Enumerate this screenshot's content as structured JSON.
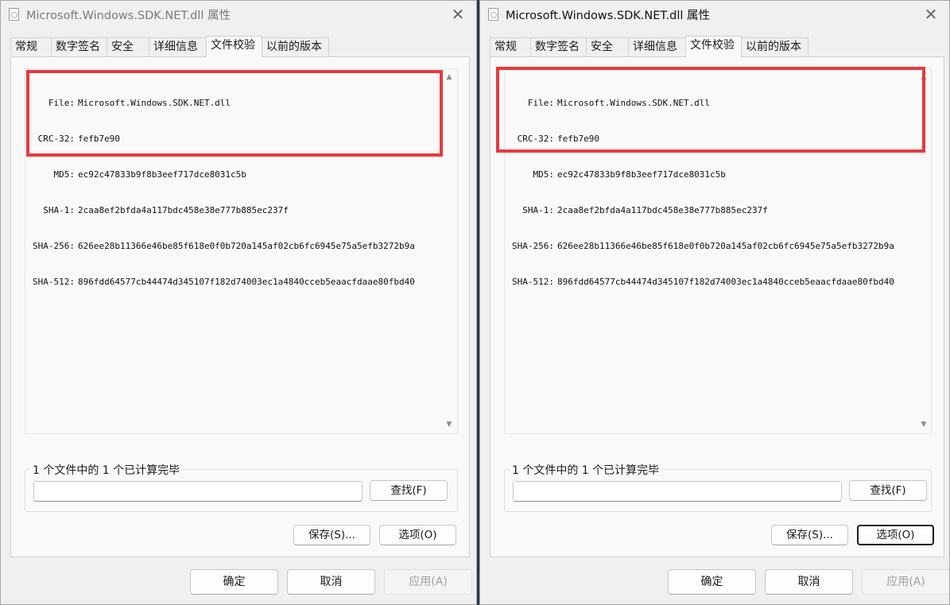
{
  "windows": [
    {
      "id": "left",
      "title": "Microsoft.Windows.SDK.NET.dll 属性",
      "tabs": [
        "常规",
        "数字签名",
        "安全",
        "详细信息",
        "文件校验",
        "以前的版本"
      ],
      "active_tab": "文件校验",
      "hashes": [
        {
          "label": "File:",
          "value": "Microsoft.Windows.SDK.NET.dll"
        },
        {
          "label": "CRC-32:",
          "value": "fefb7e90"
        },
        {
          "label": "MD5:",
          "value": "ec92c47833b9f8b3eef717dce8031c5b"
        },
        {
          "label": "SHA-1:",
          "value": "2caa8ef2bfda4a117bdc458e38e777b885ec237f"
        },
        {
          "label": "SHA-256:",
          "value": "626ee28b11366e46be85f618e0f0b720a145af02cb6fc6945e75a5efb3272b9a"
        },
        {
          "label": "SHA-512:",
          "value": "896fdd64577cb44474d345107f182d74003ec1a4840cceb5eaacfdaae80fbd40"
        }
      ],
      "status": "1 个文件中的 1 个已计算完毕",
      "search_value": "",
      "find_label": "查找(F)",
      "save_label": "保存(S)...",
      "options_label": "选项(O)",
      "ok_label": "确定",
      "cancel_label": "取消",
      "apply_label": "应用(A)"
    },
    {
      "id": "right",
      "title": "Microsoft.Windows.SDK.NET.dll 属性",
      "tabs": [
        "常规",
        "数字签名",
        "安全",
        "详细信息",
        "文件校验",
        "以前的版本"
      ],
      "active_tab": "文件校验",
      "hashes": [
        {
          "label": "File:",
          "value": "Microsoft.Windows.SDK.NET.dll"
        },
        {
          "label": "CRC-32:",
          "value": "fefb7e90"
        },
        {
          "label": "MD5:",
          "value": "ec92c47833b9f8b3eef717dce8031c5b"
        },
        {
          "label": "SHA-1:",
          "value": "2caa8ef2bfda4a117bdc458e38e777b885ec237f"
        },
        {
          "label": "SHA-256:",
          "value": "626ee28b11366e46be85f618e0f0b720a145af02cb6fc6945e75a5efb3272b9a"
        },
        {
          "label": "SHA-512:",
          "value": "896fdd64577cb44474d345107f182d74003ec1a4840cceb5eaacfdaae80fbd40"
        }
      ],
      "status": "1 个文件中的 1 个已计算完毕",
      "search_value": "",
      "find_label": "查找(F)",
      "save_label": "保存(S)...",
      "options_label": "选项(O)",
      "ok_label": "确定",
      "cancel_label": "取消",
      "apply_label": "应用(A)"
    }
  ],
  "icons": {
    "close": "close-icon",
    "file": "file-icon",
    "scroll_up": "scroll-up-icon",
    "scroll_down": "scroll-down-icon"
  },
  "colors": {
    "highlight": "#e8393e",
    "window_bg": "#f0f0f0",
    "panel_bg": "#f9f9f9"
  }
}
